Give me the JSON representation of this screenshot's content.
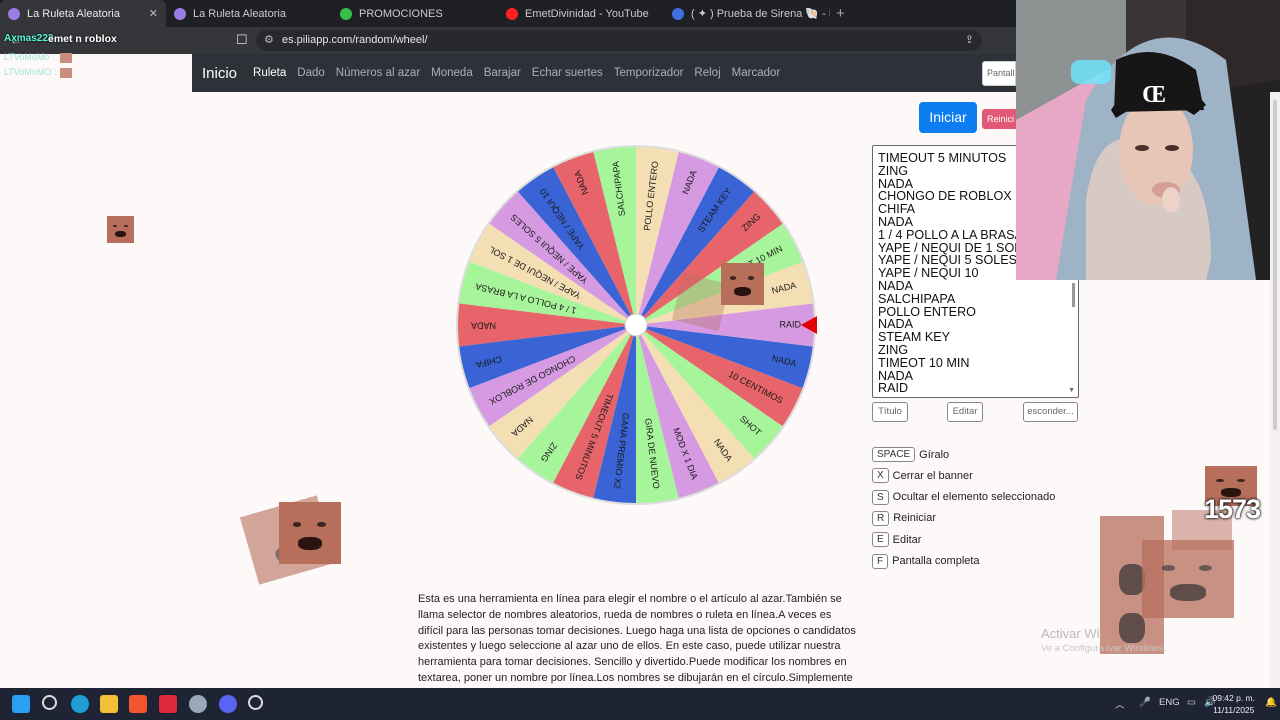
{
  "browser": {
    "tabs": [
      {
        "label": "La Ruleta Aleatoria",
        "active": true,
        "icon": "sound-icon"
      },
      {
        "label": "La Ruleta Aleatoria",
        "active": false
      },
      {
        "label": "PROMOCIONES",
        "active": false
      },
      {
        "label": "EmetDivinidad - YouTube",
        "active": false
      },
      {
        "label": "( ✦ ) Prueba de Sirena 🐚 - Roblox",
        "active": false
      }
    ],
    "url": "es.piliapp.com/random/wheel/",
    "new_tab": "+"
  },
  "chat_overlay": {
    "user": "Axmas223",
    "message": "emet n roblox",
    "lines": [
      "LTVoMoMo :",
      "LTVoMoMO :"
    ]
  },
  "site": {
    "brand": "Inicio",
    "nav": [
      "Ruleta",
      "Dado",
      "Números al azar",
      "Moneda",
      "Barajar",
      "Echar suertes",
      "Temporizador",
      "Reloj",
      "Marcador"
    ],
    "nav_active": "Ruleta",
    "nav_input_placeholder": "Pantall",
    "start_label": "Iniciar",
    "reset_label": "Reinici"
  },
  "list": {
    "items": [
      "TIMEOUT 5 MINUTOS",
      "ZING",
      "NADA",
      "CHONGO DE ROBLOX",
      "CHIFA",
      "NADA",
      "1 / 4 POLLO A LA BRASA",
      "YAPE / NEQUI DE 1 SOL",
      "YAPE / NEQUI 5 SOLES",
      "YAPE / NEQUI 10",
      "NADA",
      "SALCHIPAPA",
      "POLLO ENTERO",
      "NADA",
      "STEAM KEY",
      "ZING",
      "TIMEOT 10 MIN",
      "NADA",
      "RAID"
    ],
    "buttons": {
      "title": "Título",
      "edit": "Editar",
      "hide": "esconder..."
    }
  },
  "shortcuts": [
    {
      "key": "SPACE",
      "label": "Gíralo"
    },
    {
      "key": "X",
      "label": "Cerrar el banner"
    },
    {
      "key": "S",
      "label": "Ocultar el elemento seleccionado"
    },
    {
      "key": "R",
      "label": "Reiniciar"
    },
    {
      "key": "E",
      "label": "Editar"
    },
    {
      "key": "F",
      "label": "Pantalla completa"
    }
  ],
  "description": "Esta es una herramienta en línea para elegir el nombre o el artículo al azar.También se llama selector de nombres aleatorios, rueda de nombres o ruleta en línea.A veces es difícil para las personas tomar decisiones. Luego haga una lista de opciones o candidatos existentes y luego seleccione al azar uno de ellos. En este caso, puede utilizar nuestra herramienta para tomar decisiones. Sencillo y divertido.Puede modificar los nombres en textarea, poner un nombre por línea.Los nombres se dibujarán en el círculo.Simplemente haga clic en la rueda",
  "wheel": {
    "segments": [
      {
        "label": "RAID",
        "color": "#f4dfb4"
      },
      {
        "label": "NADA",
        "color": "#a7f59a"
      },
      {
        "label": "TIMEOT 10 MIN",
        "color": "#e7656a"
      },
      {
        "label": "ZING",
        "color": "#3a63d6"
      },
      {
        "label": "STEAM KEY",
        "color": "#d59ae2"
      },
      {
        "label": "NADA",
        "color": "#f4dfb4"
      },
      {
        "label": "POLLO ENTERO",
        "color": "#a7f59a"
      },
      {
        "label": "SALCHIPAPA",
        "color": "#e7656a"
      },
      {
        "label": "NADA",
        "color": "#3a63d6"
      },
      {
        "label": "YAPE / NEQUI 10",
        "color": "#d59ae2"
      },
      {
        "label": "YAPE / NEQUI 5 SOLES",
        "color": "#f4dfb4"
      },
      {
        "label": "YAPE / NEQUI DE 1 SOL",
        "color": "#a7f59a"
      },
      {
        "label": "1 / 4 POLLO A LA BRASA",
        "color": "#e7656a"
      },
      {
        "label": "NADA",
        "color": "#3a63d6"
      },
      {
        "label": "CHIFA",
        "color": "#d59ae2"
      },
      {
        "label": "CHONGO DE ROBLOX",
        "color": "#f4dfb4"
      },
      {
        "label": "NADA",
        "color": "#a7f59a"
      },
      {
        "label": "ZING",
        "color": "#e7656a"
      },
      {
        "label": "TIMEOUT 5 MINUTOS",
        "color": "#3a63d6"
      },
      {
        "label": "GANA PREMIO X2",
        "color": "#a7f59a"
      },
      {
        "label": "GIRA DE NUEVO",
        "color": "#d59ae2"
      },
      {
        "label": "MOD X 1 DIA",
        "color": "#f4dfb4"
      },
      {
        "label": "NADA",
        "color": "#a7f59a"
      },
      {
        "label": "SHOT",
        "color": "#e7656a"
      },
      {
        "label": "10 CENTIMOS",
        "color": "#3a63d6"
      },
      {
        "label": "NADA",
        "color": "#d59ae2"
      }
    ],
    "pointer_color": "#e00000"
  },
  "stream": {
    "counter": "1573"
  },
  "windows": {
    "watermark_title": "Activar Wi",
    "watermark_sub": "Ve a Configura      ivar Windows.",
    "lang": "ENG",
    "time": "09:42 p. m.",
    "date": "11/11/2025"
  }
}
